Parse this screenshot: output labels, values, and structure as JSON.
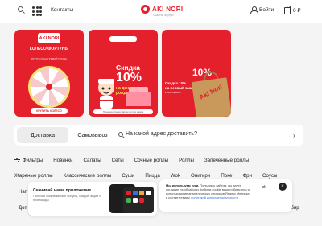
{
  "header": {
    "contacts_label": "Контакты",
    "logo_text": "AKI NORI",
    "logo_tagline": "Счастье внутри",
    "login_label": "Войти",
    "cart_total": "0 ₽"
  },
  "banners": [
    {
      "logo": "AKI NORI",
      "title": "КОЛЕСО ФОРТУНЫ",
      "subtitle": "КРУТИ И ВЫИГРЫВАЙ ПРИЗЫ",
      "button": "КРУТИТЬ КОЛЕСО"
    },
    {
      "title": "Скидка",
      "percent": "10%",
      "subtitle_line1": "на день",
      "subtitle_line2": "рождения",
      "note": "Промокод предоставляется при заказе"
    },
    {
      "percent": "10%",
      "text_line1": "Скидка 10%",
      "text_line2": "на первый заказ",
      "subtext": "в приложении",
      "bag_text": "Aki Nori"
    }
  ],
  "delivery": {
    "tab_delivery": "Доставка",
    "tab_pickup": "Самовывоз",
    "address_placeholder": "На какой адрес доставить?",
    "arrow": "›"
  },
  "categories_row1": [
    "Фильтры",
    "Новинки",
    "Салаты",
    "Сеты",
    "Сочные роллы",
    "Роллы",
    "Запеченные роллы"
  ],
  "categories_row2": [
    "Жареные роллы",
    "Классические роллы",
    "Суши",
    "Пицца",
    "Wok",
    "Онигири",
    "Поке",
    "Фри",
    "Соусы"
  ],
  "row3_partial": "Нап",
  "row4_partial": "Доп",
  "row4_right": "баби и имбир",
  "app_popup": {
    "title": "Скачивай наше приложение",
    "text": "Получай эксклюзивные бонусы, скидки, акции и промокоды"
  },
  "cookie": {
    "bold": "Мы используем куки.",
    "text": "Пользуясь сайтом, вы даете согласие на обработку файлов cookie вашего браузера и использование аналитических сервисов Яндекс Метрика в соответствии с",
    "link": "политикой конфиденциальности",
    "ok_label": "ok",
    "close_label": "×"
  },
  "colors": {
    "brand_red": "#e4202c",
    "background": "#f4f4f4"
  }
}
